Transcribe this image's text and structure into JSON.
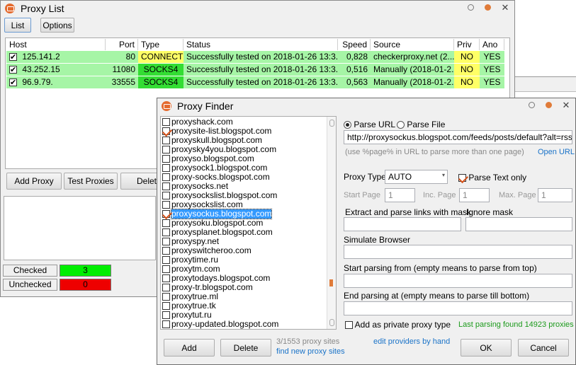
{
  "proxy_list": {
    "title": "Proxy List",
    "menu": [
      "List",
      "Options"
    ],
    "columns": [
      "Host",
      "Port",
      "Type",
      "Status",
      "Speed",
      "Source",
      "Priv",
      "Ano"
    ],
    "rows": [
      {
        "host": "125.141.2",
        "port": "80",
        "type": "CONNECT",
        "status": "Successfully tested on 2018-01-26 13:3...",
        "speed": "0,828",
        "source": "checkerproxy.net (2...",
        "priv": "NO",
        "ano": "YES"
      },
      {
        "host": "43.252.15",
        "port": "11080",
        "type": "SOCKS4",
        "status": "Successfully tested on 2018-01-26 13:3...",
        "speed": "0,516",
        "source": "Manually (2018-01-2...",
        "priv": "NO",
        "ano": "YES"
      },
      {
        "host": "96.9.79.",
        "port": "33555",
        "type": "SOCKS4",
        "status": "Successfully tested on 2018-01-26 13:3...",
        "speed": "0,563",
        "source": "Manually (2018-01-2...",
        "priv": "NO",
        "ano": "YES"
      }
    ],
    "buttons": {
      "add_proxy": "Add Proxy",
      "test_proxies": "Test Proxies",
      "delete": "Delete"
    },
    "checked_label": "Checked",
    "checked_count": "3",
    "unchecked_label": "Unchecked",
    "unchecked_count": "0"
  },
  "finder": {
    "title": "Proxy Finder",
    "sites": [
      {
        "name": "proxyshack.com",
        "state": "none"
      },
      {
        "name": "proxysite-list.blogspot.com",
        "state": "orange"
      },
      {
        "name": "proxyskull.blogspot.com",
        "state": "none"
      },
      {
        "name": "proxysky4you.blogspot.com",
        "state": "none"
      },
      {
        "name": "proxyso.blogspot.com",
        "state": "none"
      },
      {
        "name": "proxysock1.blogspot.com",
        "state": "none"
      },
      {
        "name": "proxy-socks.blogspot.com",
        "state": "none"
      },
      {
        "name": "proxysocks.net",
        "state": "none"
      },
      {
        "name": "proxysockslist.blogspot.com",
        "state": "none"
      },
      {
        "name": "proxysockslist.com",
        "state": "none"
      },
      {
        "name": "proxysockus.blogspot.com",
        "state": "orange",
        "selected": true
      },
      {
        "name": "proxysoku.blogspot.com",
        "state": "none"
      },
      {
        "name": "proxysplanet.blogspot.com",
        "state": "none"
      },
      {
        "name": "proxyspy.net",
        "state": "none"
      },
      {
        "name": "proxyswitcheroo.com",
        "state": "none"
      },
      {
        "name": "proxytime.ru",
        "state": "none"
      },
      {
        "name": "proxytm.com",
        "state": "none"
      },
      {
        "name": "proxytodays.blogspot.com",
        "state": "none"
      },
      {
        "name": "proxy-tr.blogspot.com",
        "state": "none"
      },
      {
        "name": "proxytrue.ml",
        "state": "none"
      },
      {
        "name": "proxytrue.tk",
        "state": "none"
      },
      {
        "name": "proxytut.ru",
        "state": "none"
      },
      {
        "name": "proxy-updated.blogspot.com",
        "state": "none"
      }
    ],
    "parse_url_label": "Parse URL",
    "parse_file_label": "Parse File",
    "url_value": "http://proxysockus.blogspot.com/feeds/posts/default?alt=rss",
    "url_hint": "(use %page% in URL to parse more than one page)",
    "open_url": "Open URL",
    "proxy_type_label": "Proxy Type",
    "proxy_type_value": "AUTO",
    "parse_text_only": "Parse Text only",
    "start_page_label": "Start Page",
    "start_page_value": "1",
    "inc_page_label": "Inc. Page",
    "inc_page_value": "1",
    "max_page_label": "Max. Page",
    "max_page_value": "1",
    "extract_label": "Extract and parse links with mask",
    "ignore_label": "Ignore mask",
    "simulate_label": "Simulate Browser",
    "start_parsing_label": "Start parsing from (empty means to parse from top)",
    "end_parsing_label": "End parsing at (empty means to parse till bottom)",
    "private_label": "Add as private proxy type",
    "last_parsing": "Last parsing found 14923 proxies",
    "add_btn": "Add",
    "delete_btn": "Delete",
    "site_count": "3/1553 proxy sites",
    "find_new": "find new proxy sites",
    "edit_providers": "edit providers by hand",
    "ok_btn": "OK",
    "cancel_btn": "Cancel"
  },
  "colors": {
    "ok_green": "#a6f5a6",
    "bright_green": "#33dd33",
    "yellow": "#ffff66",
    "checked_green": "#00ee00",
    "unchecked_red": "#ee0000",
    "link_blue": "#1a73c8",
    "status_green": "#1c9a1c"
  }
}
